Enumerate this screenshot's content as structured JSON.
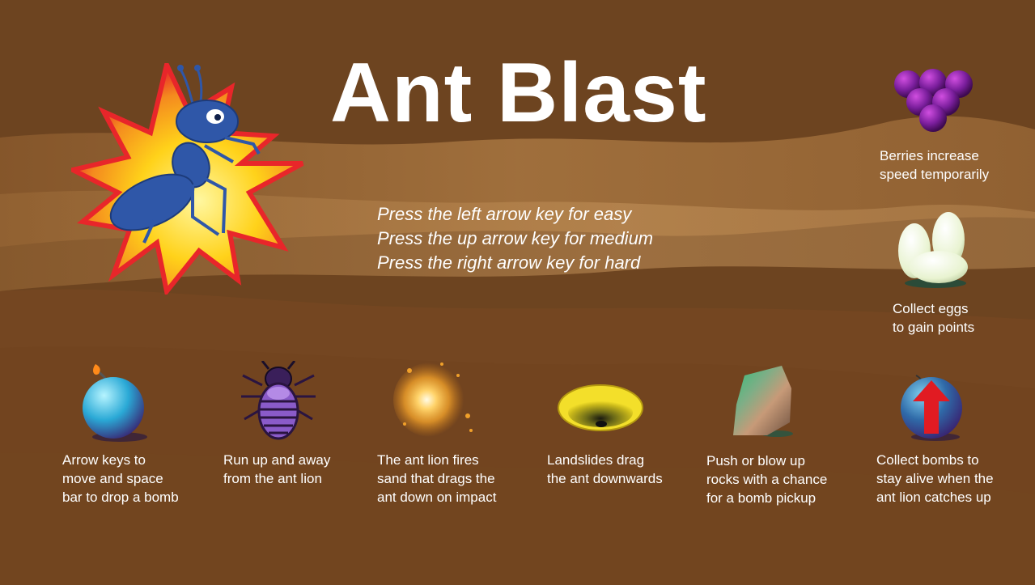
{
  "title": "Ant Blast",
  "difficulty": {
    "lines": [
      "Press the left arrow key for easy",
      "Press the up arrow key for medium",
      "Press the right arrow key for hard"
    ]
  },
  "side_tips": [
    {
      "icon": "berries-icon",
      "lines": [
        "Berries increase",
        "speed temporarily"
      ]
    },
    {
      "icon": "eggs-icon",
      "lines": [
        "Collect eggs",
        "to gain points"
      ]
    }
  ],
  "bottom_tips": [
    {
      "icon": "bomb-icon",
      "lines": [
        "Arrow keys to",
        "move and space",
        "bar to drop a bomb"
      ]
    },
    {
      "icon": "ant-lion-icon",
      "lines": [
        "Run up and away",
        "from the ant lion"
      ]
    },
    {
      "icon": "sand-blast-icon",
      "lines": [
        "The ant lion fires",
        "sand that drags the",
        "ant down on impact"
      ]
    },
    {
      "icon": "landslide-hole-icon",
      "lines": [
        "Landslides drag",
        "the ant downwards"
      ]
    },
    {
      "icon": "rock-icon",
      "lines": [
        "Push or blow up",
        "rocks with a chance",
        "for a bomb pickup"
      ]
    },
    {
      "icon": "bomb-pickup-icon",
      "lines": [
        "Collect bombs to",
        "stay alive when the",
        "ant lion catches up"
      ]
    }
  ],
  "colors": {
    "background": "#764a22",
    "text": "#ffffff",
    "ant": "#2f57a8",
    "explosion_outer": "#e8262a",
    "explosion_inner": "#ffd21a",
    "berries": "#7a1e9c",
    "bomb": "#2aa9d6",
    "arrow": "#e11b22"
  }
}
